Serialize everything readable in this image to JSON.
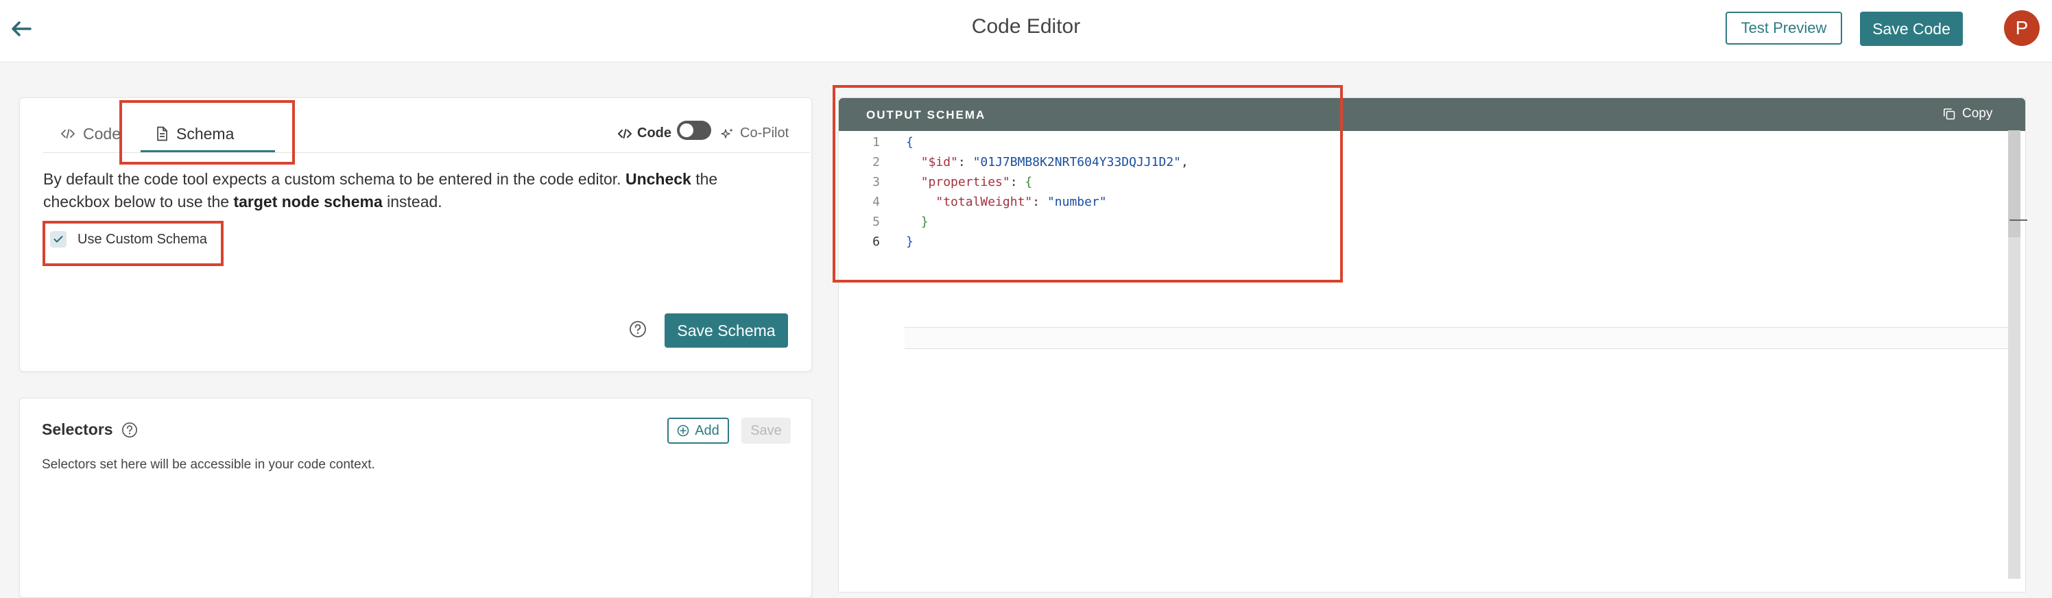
{
  "header": {
    "title": "Code Editor",
    "test_preview_label": "Test Preview",
    "save_code_label": "Save Code",
    "avatar_initial": "P"
  },
  "schema_card": {
    "tabs": [
      {
        "label": "Code",
        "icon": "code-icon"
      },
      {
        "label": "Schema",
        "icon": "file-icon",
        "active": true
      }
    ],
    "mode_code_label": "Code",
    "mode_copilot_label": "Co-Pilot",
    "toggle_on": false,
    "description": {
      "part1": "By default the code tool expects a custom schema to be entered in the code editor. ",
      "bold1": "Uncheck",
      "part2": " the checkbox below to use the ",
      "bold2": "target node schema",
      "part3": " instead."
    },
    "checkbox_label": "Use Custom Schema",
    "checkbox_checked": true,
    "save_schema_label": "Save Schema"
  },
  "selectors_card": {
    "title": "Selectors",
    "add_label": "Add",
    "save_label": "Save",
    "description": "Selectors set here will be accessible in your code context."
  },
  "output_schema": {
    "title": "OUTPUT SCHEMA",
    "copy_label": "Copy",
    "lines": [
      {
        "num": "1",
        "parts": [
          [
            "b1",
            "{"
          ]
        ]
      },
      {
        "num": "2",
        "parts": [
          [
            "p",
            "  "
          ],
          [
            "k",
            "\"$id\""
          ],
          [
            "p",
            ": "
          ],
          [
            "s",
            "\"01J7BMB8K2NRT604Y33DQJJ1D2\""
          ],
          [
            "p",
            ","
          ]
        ]
      },
      {
        "num": "3",
        "parts": [
          [
            "p",
            "  "
          ],
          [
            "k",
            "\"properties\""
          ],
          [
            "p",
            ": "
          ],
          [
            "b2",
            "{"
          ]
        ]
      },
      {
        "num": "4",
        "parts": [
          [
            "p",
            "    "
          ],
          [
            "k",
            "\"totalWeight\""
          ],
          [
            "p",
            ": "
          ],
          [
            "s",
            "\"number\""
          ]
        ]
      },
      {
        "num": "5",
        "parts": [
          [
            "p",
            "  "
          ],
          [
            "b2",
            "}"
          ]
        ]
      },
      {
        "num": "6",
        "parts": [
          [
            "b1",
            "}"
          ]
        ]
      }
    ]
  },
  "colors": {
    "accent": "#2e7a83",
    "avatar": "#bf3d21",
    "panel_header": "#5b6b6a",
    "annotation": "#d9432e"
  }
}
